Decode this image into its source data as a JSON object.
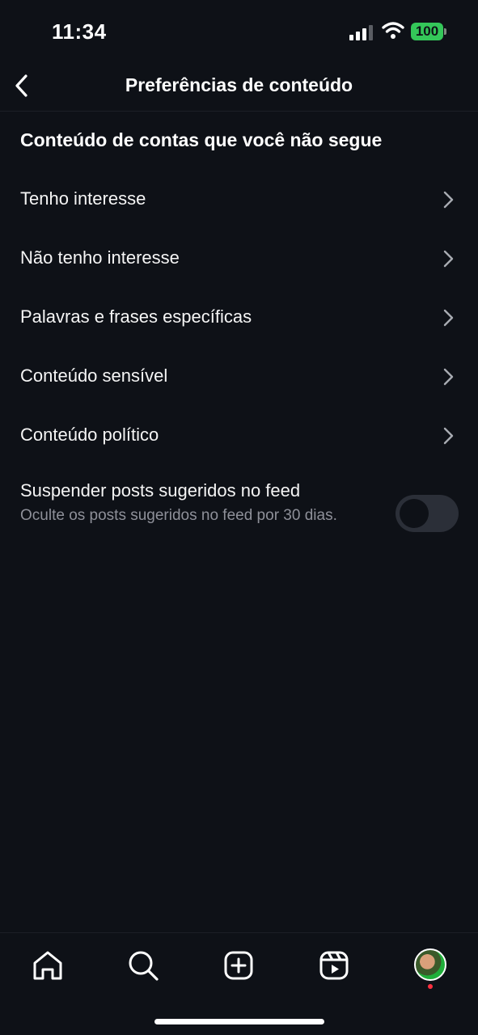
{
  "status_bar": {
    "time": "11:34",
    "battery": "100",
    "battery_color": "#34c759"
  },
  "header": {
    "title": "Preferências de conteúdo",
    "back_icon": "chevron-left-icon"
  },
  "section": {
    "title": "Conteúdo de contas que você não segue"
  },
  "menu_items": [
    {
      "label": "Tenho interesse"
    },
    {
      "label": "Não tenho interesse"
    },
    {
      "label": "Palavras e frases específicas"
    },
    {
      "label": "Conteúdo sensível"
    },
    {
      "label": "Conteúdo político"
    }
  ],
  "snooze": {
    "title": "Suspender posts sugeridos no feed",
    "description": "Oculte os posts sugeridos no feed por 30 dias.",
    "enabled": false
  },
  "bottom_nav": {
    "items": [
      "home-icon",
      "search-icon",
      "create-icon",
      "reels-icon",
      "profile-avatar"
    ],
    "notification_color": "#ff3040"
  },
  "theme": {
    "background": "#0e1117",
    "text_primary": "#f5f5f5",
    "text_secondary": "#8e9099"
  }
}
